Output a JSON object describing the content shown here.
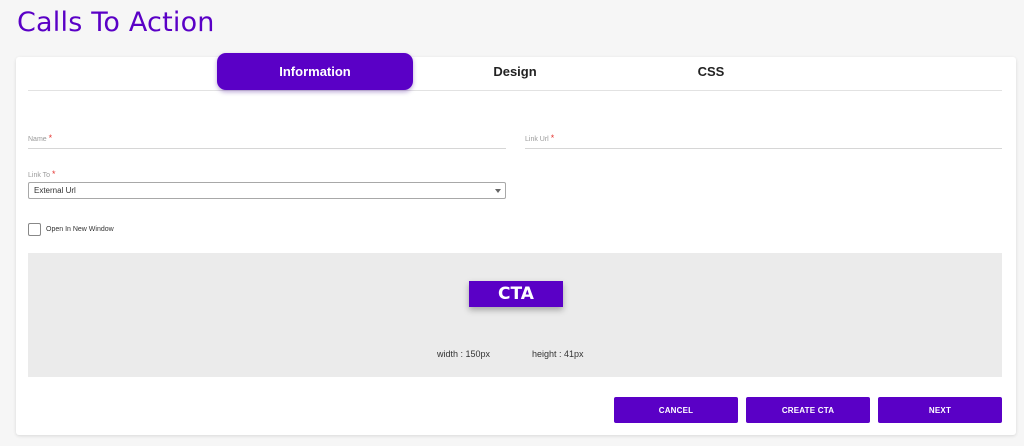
{
  "page": {
    "title": "Calls To Action"
  },
  "tabs": [
    {
      "label": "Information",
      "active": true
    },
    {
      "label": "Design",
      "active": false
    },
    {
      "label": "CSS",
      "active": false
    }
  ],
  "form": {
    "name_label": "Name",
    "name_value": "",
    "link_url_label": "Link Url",
    "link_url_value": "",
    "required_marker": "*",
    "link_to_label": "Link To",
    "link_to_value": "External Url",
    "open_new_window_label": "Open In New Window",
    "open_new_window_checked": false
  },
  "preview": {
    "cta_label": "CTA",
    "width_text": "width : 150px",
    "height_text": "height : 41px"
  },
  "actions": {
    "cancel": "CANCEL",
    "create": "CREATE CTA",
    "next": "NEXT"
  },
  "colors": {
    "accent": "#5a00c6",
    "required": "#e53935",
    "preview_bg": "#ebebeb"
  }
}
